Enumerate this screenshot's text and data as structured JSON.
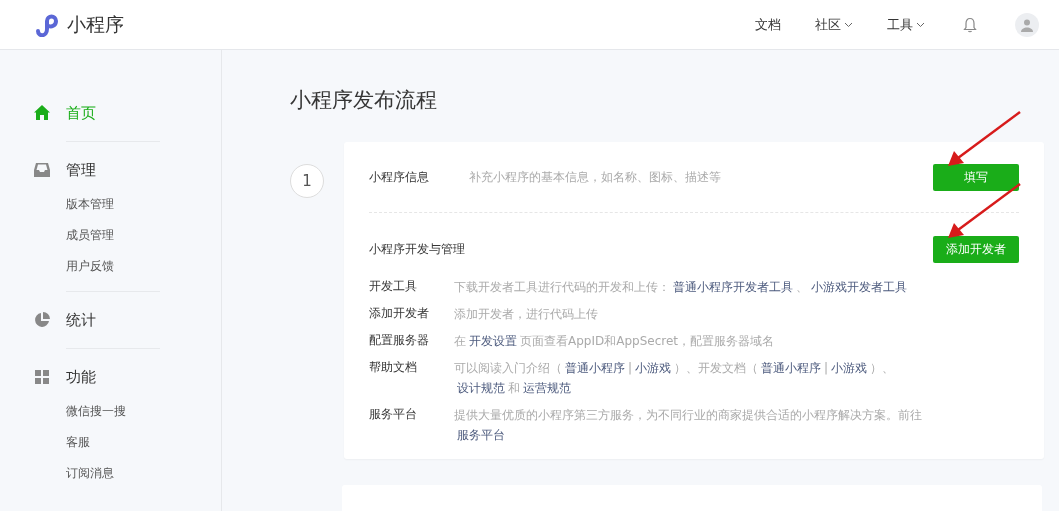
{
  "header": {
    "brand": "小程序",
    "nav": [
      {
        "label": "文档",
        "has_menu": false
      },
      {
        "label": "社区",
        "has_menu": true
      },
      {
        "label": "工具",
        "has_menu": true
      }
    ]
  },
  "sidebar": {
    "groups": [
      {
        "label": "首页",
        "selected": true
      },
      {
        "label": "管理",
        "selected": false,
        "children": [
          {
            "label": "版本管理"
          },
          {
            "label": "成员管理"
          },
          {
            "label": "用户反馈"
          }
        ]
      },
      {
        "label": "统计",
        "selected": false
      },
      {
        "label": "功能",
        "selected": false,
        "children": [
          {
            "label": "微信搜一搜"
          },
          {
            "label": "客服"
          },
          {
            "label": "订阅消息"
          }
        ]
      }
    ]
  },
  "page_title": "小程序发布流程",
  "steps": [
    {
      "number": "1",
      "sections": [
        {
          "title": "小程序信息",
          "summary": "补充小程序的基本信息，如名称、图标、描述等",
          "button": {
            "label": "填写",
            "pointed": true
          }
        },
        {
          "title": "小程序开发与管理",
          "button": {
            "label": "添加开发者",
            "pointed": true
          },
          "items": [
            {
              "label": "开发工具",
              "description": [
                {
                  "text": "下载开发者工具进行代码的开发和上传：",
                  "link": false
                },
                {
                  "text": "普通小程序开发者工具",
                  "link": true
                },
                {
                  "text": "、",
                  "link": false
                },
                {
                  "text": "小游戏开发者工具",
                  "link": true
                }
              ]
            },
            {
              "label": "添加开发者",
              "description": [
                {
                  "text": "添加开发者，进行代码上传",
                  "link": false
                }
              ]
            },
            {
              "label": "配置服务器",
              "description": [
                {
                  "text": "在",
                  "link": false
                },
                {
                  "text": "开发设置",
                  "link": true
                },
                {
                  "text": "页面查看AppID和AppSecret，配置服务器域名",
                  "link": false
                }
              ]
            },
            {
              "label": "帮助文档",
              "description": [
                {
                  "text": "可以阅读入门介绍（",
                  "link": false
                },
                {
                  "text": "普通小程序",
                  "link": true
                },
                {
                  "text": "|",
                  "link": false
                },
                {
                  "text": "小游戏",
                  "link": true
                },
                {
                  "text": "）、开发文档（",
                  "link": false
                },
                {
                  "text": "普通小程序",
                  "link": true
                },
                {
                  "text": "|",
                  "link": false
                },
                {
                  "text": "小游戏",
                  "link": true
                },
                {
                  "text": "）、",
                  "link": false
                },
                {
                  "text": "设计规范",
                  "link": true
                },
                {
                  "text": "和",
                  "link": false
                },
                {
                  "text": "运营规范",
                  "link": true
                }
              ]
            },
            {
              "label": "服务平台",
              "description": [
                {
                  "text": "提供大量优质的小程序第三方服务，为不同行业的商家提供合适的小程序解决方案。前往",
                  "link": false
                },
                {
                  "text": "服务平台",
                  "link": true
                }
              ]
            }
          ]
        }
      ]
    }
  ]
}
